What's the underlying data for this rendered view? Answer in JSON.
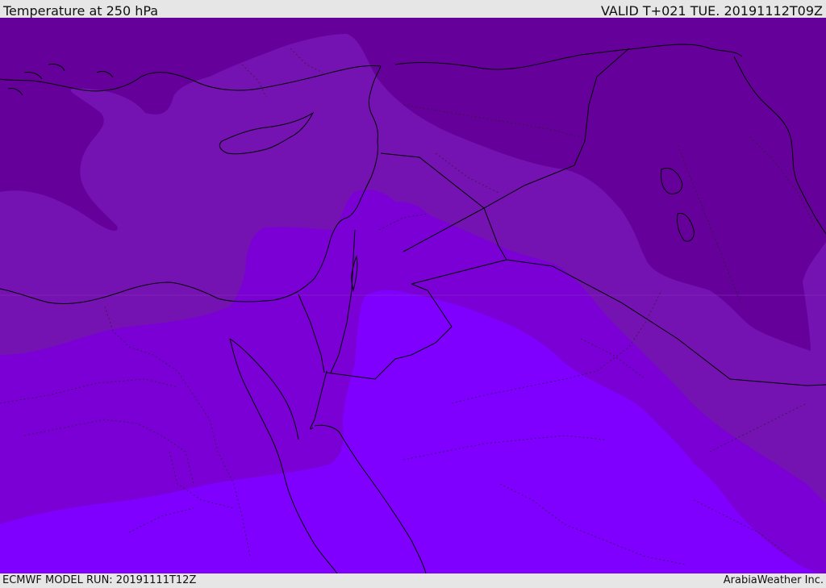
{
  "header": {
    "title": "Temperature at 250 hPa",
    "valid": "VALID T+021 TUE. 20191112T09Z"
  },
  "footer": {
    "model_run": "ECMWF MODEL RUN: 20191111T12Z",
    "credit": "ArabiaWeather Inc."
  },
  "map": {
    "field": "Temperature at 250 hPa",
    "colors": {
      "coldest": "#66009a",
      "cold": "#7412b2",
      "mid": "#7a00d6",
      "warm": "#7f00ff",
      "border": "#000000"
    }
  }
}
